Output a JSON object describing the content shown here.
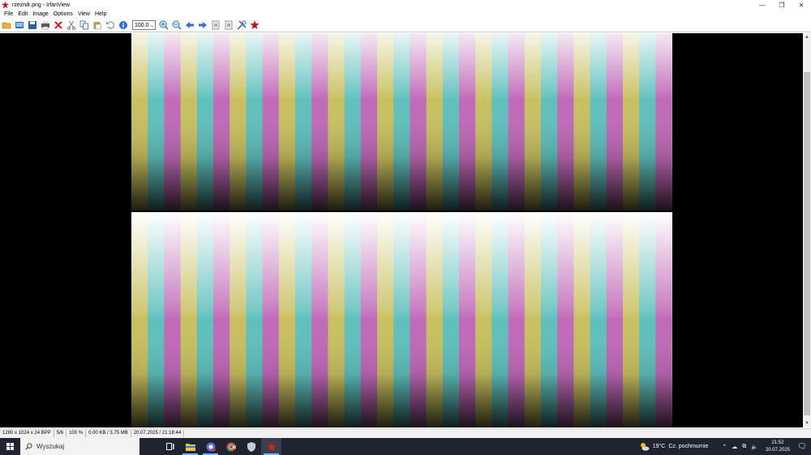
{
  "window": {
    "title": "rzeznik.png - IrfanView",
    "minimize_icon": "minimize-icon",
    "restore_icon": "restore-icon",
    "close_icon": "close-icon"
  },
  "menu": [
    "File",
    "Edit",
    "Image",
    "Options",
    "View",
    "Help"
  ],
  "toolbar": {
    "zoom_value": "100.0",
    "icons": [
      "open-folder-icon",
      "slideshow-icon",
      "save-icon",
      "print-icon",
      "delete-icon",
      "cut-icon",
      "copy-icon",
      "paste-icon",
      "undo-icon",
      "info-icon",
      "zoom-in-icon",
      "zoom-out-icon",
      "previous-icon",
      "next-icon",
      "first-page-icon",
      "last-page-icon",
      "settings-icon",
      "irfanview-logo-icon"
    ]
  },
  "image": {
    "stripe_colors": [
      "#c06ab8",
      "#c8c060",
      "#60c0bc",
      "#c06ab8",
      "#c8c060",
      "#60c0bc"
    ]
  },
  "status": {
    "dimensions": "1280 x 1024 x 24 BPP",
    "index": "5/6",
    "zoom": "100 %",
    "size": "0.00 KB / 3.75 MB",
    "datetime": "20.07.2025 / 21:18:44"
  },
  "taskbar": {
    "search_placeholder": "Wyszukaj",
    "weather_temp": "19°C",
    "weather_desc": "Cz. pochmurnie",
    "time": "21:52",
    "date": "20.07.2025",
    "apps": [
      "task-view-icon",
      "file-explorer-icon",
      "chat-app-icon",
      "chrome-icon",
      "security-shield-icon",
      "irfanview-taskbar-icon"
    ]
  },
  "scrollbar": {
    "position": 0.1
  }
}
